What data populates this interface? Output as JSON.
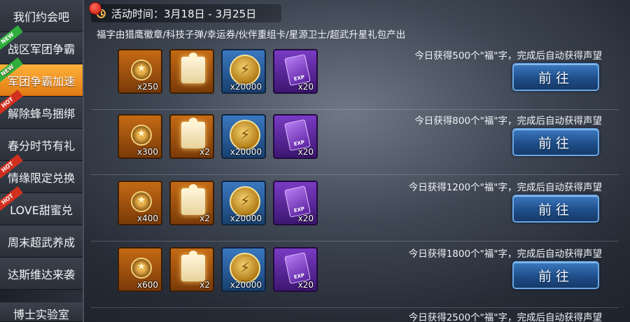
{
  "sidebar": {
    "items": [
      {
        "label": "我们约会吧",
        "tag": ""
      },
      {
        "label": "战区军团争霸",
        "tag": "NEW"
      },
      {
        "label": "军团争霸加速",
        "tag": "NEW"
      },
      {
        "label": "解除蜂鸟捆绑",
        "tag": "HOT"
      },
      {
        "label": "春分时节有礼",
        "tag": ""
      },
      {
        "label": "情缘限定兑换",
        "tag": "HOT"
      },
      {
        "label": "LOVE甜蜜兑",
        "tag": "HOT"
      },
      {
        "label": "周末超武养成",
        "tag": ""
      },
      {
        "label": "达斯维达来袭",
        "tag": ""
      },
      {
        "label": "博士实验室",
        "tag": ""
      }
    ],
    "active_index": 2,
    "colors": {
      "active": "#f0961f",
      "new_tag": "#2fae3c",
      "hot_tag": "#d2301f"
    }
  },
  "event": {
    "time_label": "活动时间：3月18日 - 3月25日",
    "description": "福字由猎鹰徽章/科技子弹/幸运券/伙伴重组卡/星源卫士/超武升星礼包产出"
  },
  "tasks": [
    {
      "text": "今日获得500个\"福\"字，完成后自动获得声望",
      "rewards": [
        "x250",
        "",
        "x20000",
        "x20"
      ],
      "button": "前往"
    },
    {
      "text": "今日获得800个\"福\"字，完成后自动获得声望",
      "rewards": [
        "x300",
        "x2",
        "x20000",
        "x20"
      ],
      "button": "前往"
    },
    {
      "text": "今日获得1200个\"福\"字，完成后自动获得声望",
      "rewards": [
        "x400",
        "x2",
        "x20000",
        "x20"
      ],
      "button": "前往"
    },
    {
      "text": "今日获得1800个\"福\"字，完成后自动获得声望",
      "rewards": [
        "x600",
        "x2",
        "x20000",
        "x20"
      ],
      "button": "前往"
    },
    {
      "text": "今日获得2500个\"福\"字，完成后自动获得声望",
      "rewards": [],
      "button": ""
    }
  ],
  "reward_icons": [
    "medal-badge-icon",
    "puzzle-piece-icon",
    "gold-coin-icon",
    "exp-card-icon"
  ],
  "exp_card_label": "EXP"
}
